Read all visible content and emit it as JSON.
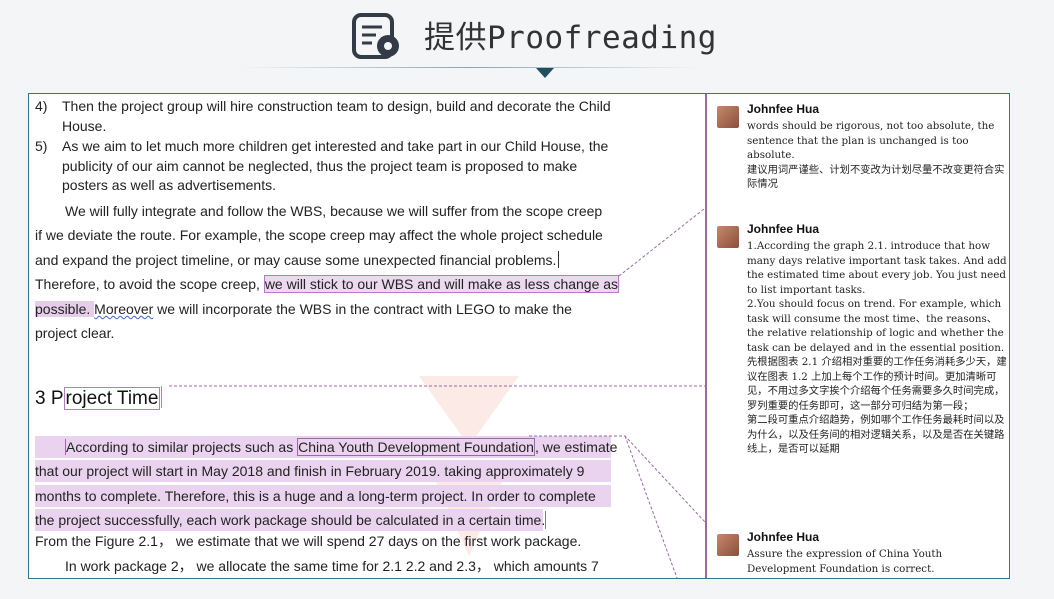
{
  "header": {
    "title_cjk": "提供",
    "title_en": "Proofreading",
    "icon": "document-gear-icon"
  },
  "document": {
    "list_items": [
      {
        "num": "4)",
        "text": "Then the project group will hire construction team to design, build and decorate the Child House."
      },
      {
        "num": "5)",
        "text": "As we aim to let much more children get interested and take part in our Child House, the publicity of our aim cannot be neglected, thus the project team is proposed to make posters as well as advertisements."
      }
    ],
    "wbs_para": {
      "line1": "We will fully integrate and follow the WBS, because we will suffer from the scope creep",
      "line2": "if we deviate the route. For example, the scope creep may affect the whole project schedule",
      "line3": "and expand the project timeline, or may cause some unexpected financial problems.",
      "line4_plain": "Therefore, to avoid the scope creep, ",
      "line4_hl": "we will stick to our WBS and will make as less change as",
      "line5_hl": "possible. ",
      "line5_wavy": "Moreover",
      "line5_rest": " we will incorporate the WBS in the contract with LEGO to make the",
      "line6": "project clear."
    },
    "heading": {
      "plain": "3 P",
      "boxed": "roject Time"
    },
    "time_para": {
      "line1_a": "According to similar projects such as ",
      "line1_b": "China Youth Development Foundation",
      "line1_c": ", we estimate",
      "line2": "that our project will start in May 2018 and finish in February 2019.  taking approximately 9",
      "line3": "months to complete. Therefore, this is a huge and a long-term project. In order to complete",
      "line4": "the project successfully, each work package should be calculated in a certain time."
    },
    "line_figure": "From the Figure 2.1，  we estimate that we will spend 27 days on the first work package.",
    "line_wp2": "In work package 2，  we allocate the same time for 2.1 2.2 and 2.3，  which amounts 7"
  },
  "comments": [
    {
      "author": "Johnfee Hua",
      "body": [
        " words should be rigorous, not too absolute, the sentence that the plan is unchanged is too absolute.",
        "建议用词严谨些、计划不变改为计划尽量不改变更符合实际情况"
      ]
    },
    {
      "author": "Johnfee Hua",
      "body": [
        "1.According the graph 2.1. introduce that how many days relative important task takes. And add the estimated time about every job. You just need to list important tasks.",
        "2.You should focus on trend. For example, which task will consume the most time、the reasons、the relative relationship of logic and whether  the task can be delayed and in the essential position.",
        "先根据图表 2.1 介绍相对重要的工作任务消耗多少天，建议在图表 1.2 上加上每个工作的预计时间。更加清晰可见，不用过多文字挨个介绍每个任务需要多久时间完成，罗列重要的任务即可，这一部分可归结为第一段；",
        "第二段可重点介绍趋势，例如哪个工作任务最耗时间以及为什么，以及任务间的相对逻辑关系，以及是否在关键路线上，是否可以延期"
      ]
    },
    {
      "author": "Johnfee Hua",
      "body": [
        "Assure the expression of China Youth Development Foundation is correct."
      ]
    }
  ],
  "colors": {
    "frame_border": "#2d7a8a",
    "highlight": "#e6cdea",
    "comment_connector": "#9a6aa6"
  }
}
